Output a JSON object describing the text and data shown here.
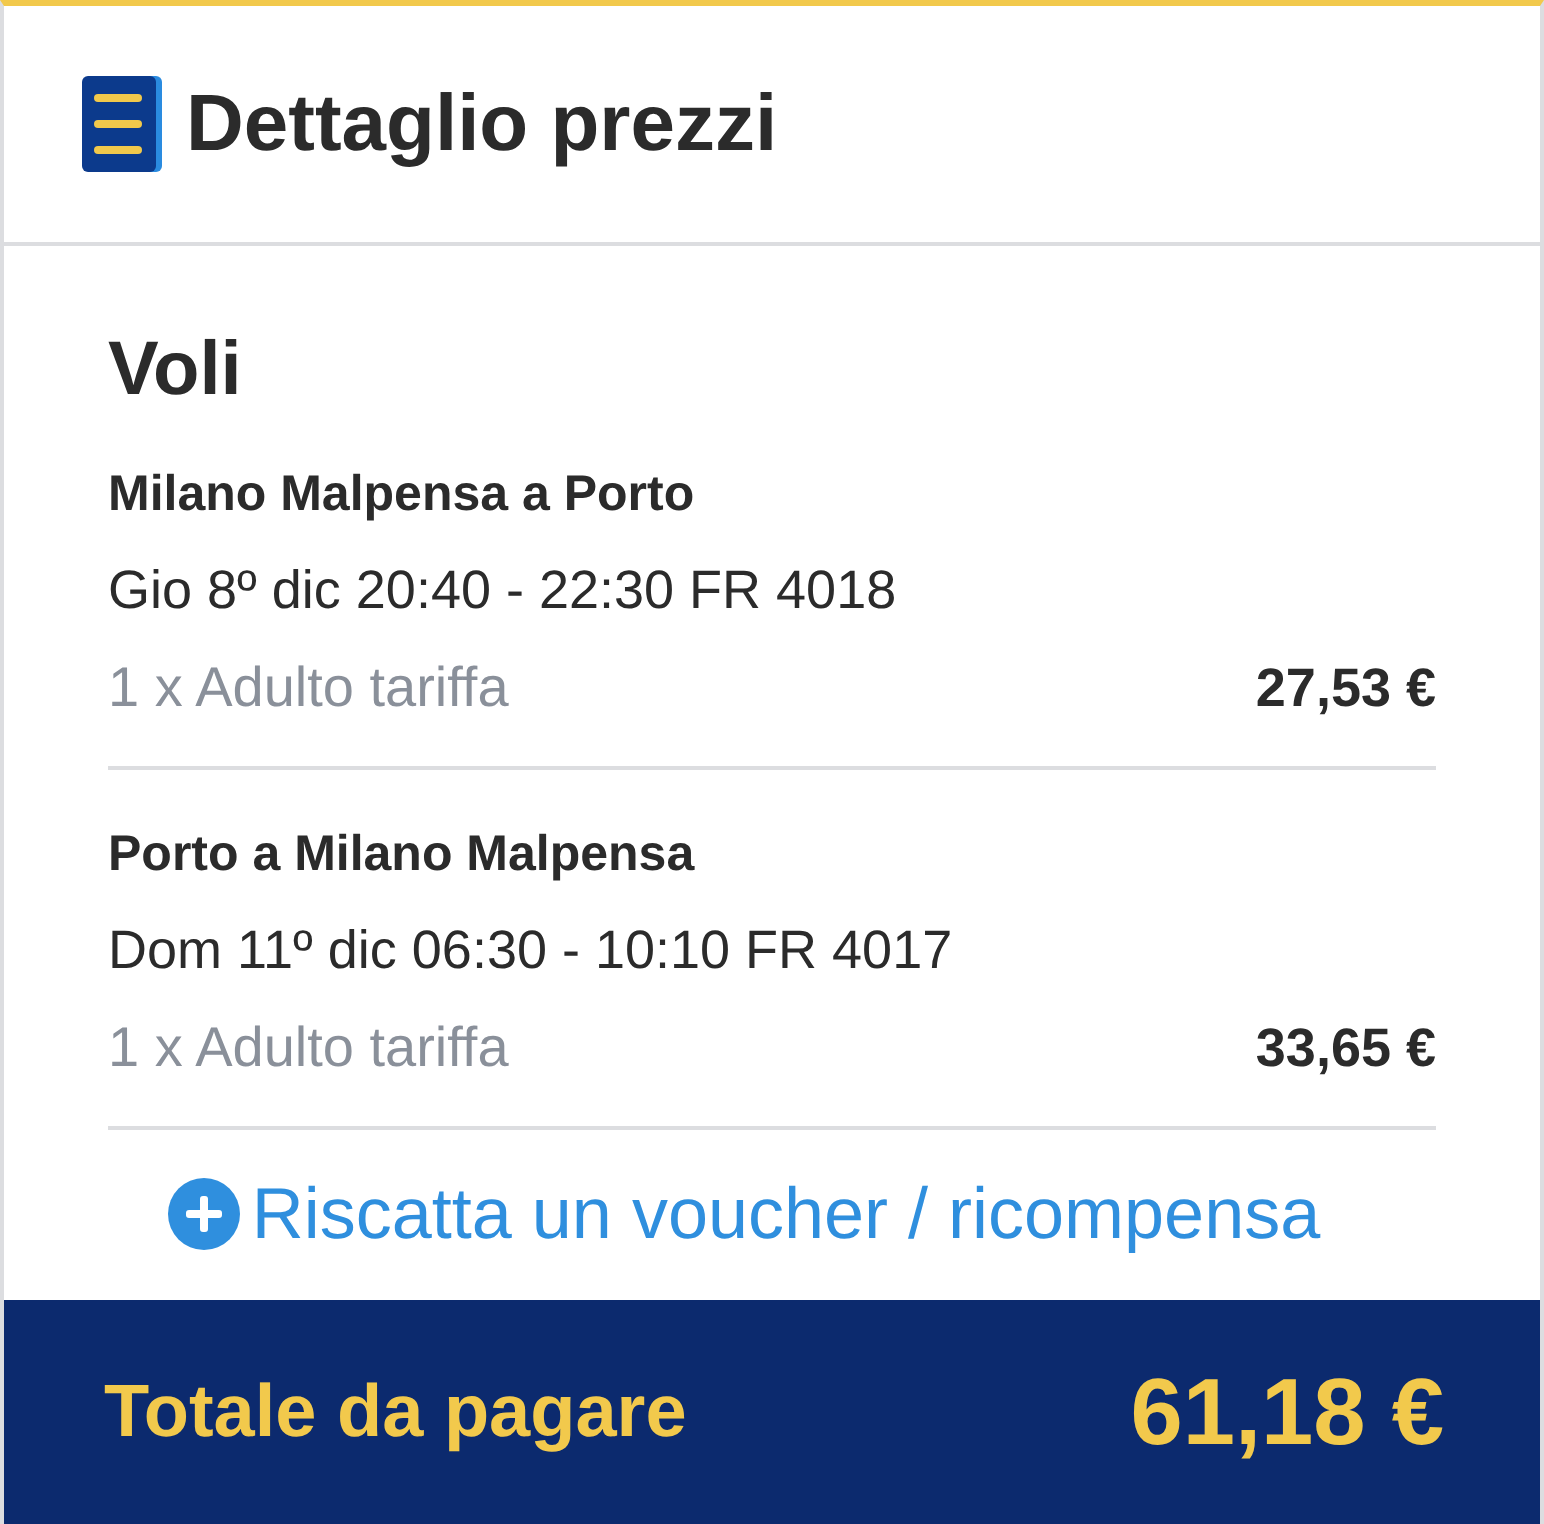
{
  "header": {
    "title": "Dettaglio prezzi"
  },
  "section": {
    "title": "Voli"
  },
  "flights": [
    {
      "route": "Milano Malpensa a Porto",
      "schedule": "Gio 8º dic 20:40 - 22:30 FR 4018",
      "fare": "1 x Adulto tariffa",
      "price": "27,53 €"
    },
    {
      "route": "Porto a Milano Malpensa",
      "schedule": "Dom 11º dic 06:30 - 10:10 FR 4017",
      "fare": "1 x Adulto tariffa",
      "price": "33,65 €"
    }
  ],
  "voucher_link": "Riscatta un voucher / ricompensa",
  "total": {
    "label": "Totale da pagare",
    "amount": "61,18 €"
  }
}
